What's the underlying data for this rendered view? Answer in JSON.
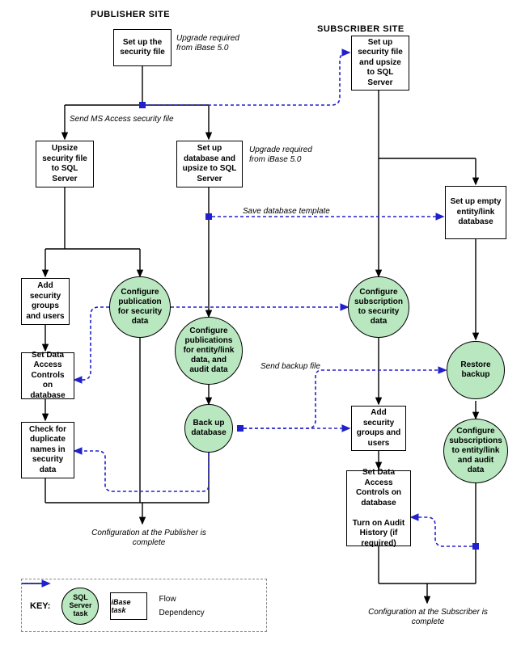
{
  "headers": {
    "publisher": "PUBLISHER SITE",
    "subscriber": "SUBSCRIBER SITE"
  },
  "nodes": {
    "pub_setup_sec": "Set up the security file",
    "note_upgrade1": "Upgrade required from iBase 5.0",
    "note_send_sec": "Send MS Access security file",
    "pub_upsize": "Upsize security file to SQL Server",
    "pub_setup_db": "Set up database and upsize to SQL Server",
    "note_upgrade2": "Upgrade required from iBase 5.0",
    "note_save_template": "Save database template",
    "pub_add_grp": "Add security groups and users",
    "pub_cfg_pub_sec": "Configure publication for security data",
    "pub_cfg_pub_ent": "Configure publications for entity/link data, and audit data",
    "pub_set_dac": "Set Data Access Controls on database",
    "pub_backup": "Back up database",
    "note_send_backup": "Send backup file",
    "pub_check_dup": "Check for duplicate names in security data",
    "note_pub_complete": "Configuration at the Publisher is complete",
    "sub_setup_sec": "Set up security file and upsize to SQL Server",
    "sub_setup_db": "Set up empty entity/link database",
    "sub_cfg_sub_sec": "Configure subscription to security data",
    "sub_restore": "Restore backup",
    "sub_add_grp": "Add security groups and users",
    "sub_cfg_sub_ent": "Configure subscriptions to entity/link and audit data",
    "sub_set_dac": "Set Data Access Controls on database\n\nTurn on Audit History (if required)",
    "note_sub_complete": "Configuration at the Subscriber is complete"
  },
  "key": {
    "title": "KEY:",
    "sql_task": "SQL Server task",
    "ibase_task": "iBase task",
    "flow": "Flow",
    "dependency": "Dependency"
  }
}
